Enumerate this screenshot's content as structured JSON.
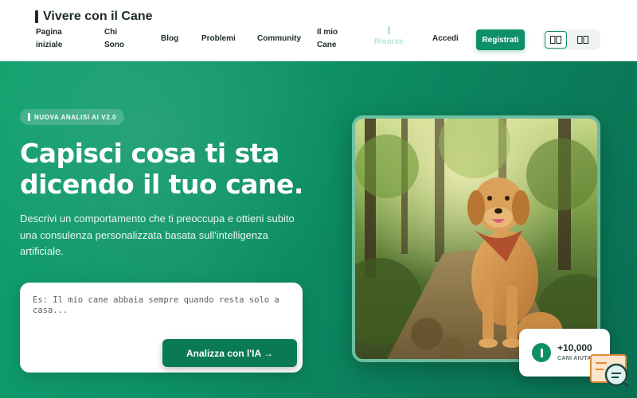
{
  "header": {
    "brand": "Vivere con il Cane",
    "nav": [
      {
        "label": "Pagina iniziale"
      },
      {
        "label": "Chi Sono"
      },
      {
        "label": "Blog"
      },
      {
        "label": "Problemi"
      },
      {
        "label": "Community"
      },
      {
        "label": "Il mio Cane"
      },
      {
        "label": "Risorse"
      },
      {
        "label": "Accedi"
      }
    ],
    "register_label": "Registrati",
    "view_toggle": {
      "options": [
        "grid-view-icon",
        "compact-view-icon"
      ],
      "selected": 0
    }
  },
  "hero": {
    "badge": "NUOVA ANALISI AI V2.0",
    "title_line1": "Capisci cosa ti sta",
    "title_line2": "dicendo il tuo cane.",
    "description": "Descrivi un comportamento che ti preoccupa e ottieni subito una consulenza personalizzata basata sull'intelligenza artificiale.",
    "input_placeholder": "Es: Il mio cane abbaia sempre quando resta solo a casa...",
    "analyze_label": "Analizza con l'IA →",
    "stat_value": "+10,000",
    "stat_label": "CANI AIUTATI"
  },
  "colors": {
    "brand_green": "#0f8f67",
    "hero_gradient_start": "#11a06d",
    "hero_gradient_end": "#0a6e52",
    "text_dark": "#1d2b26"
  },
  "icons": {
    "photo": "golden-retriever-photo",
    "chat": "chat-widget-icon"
  }
}
